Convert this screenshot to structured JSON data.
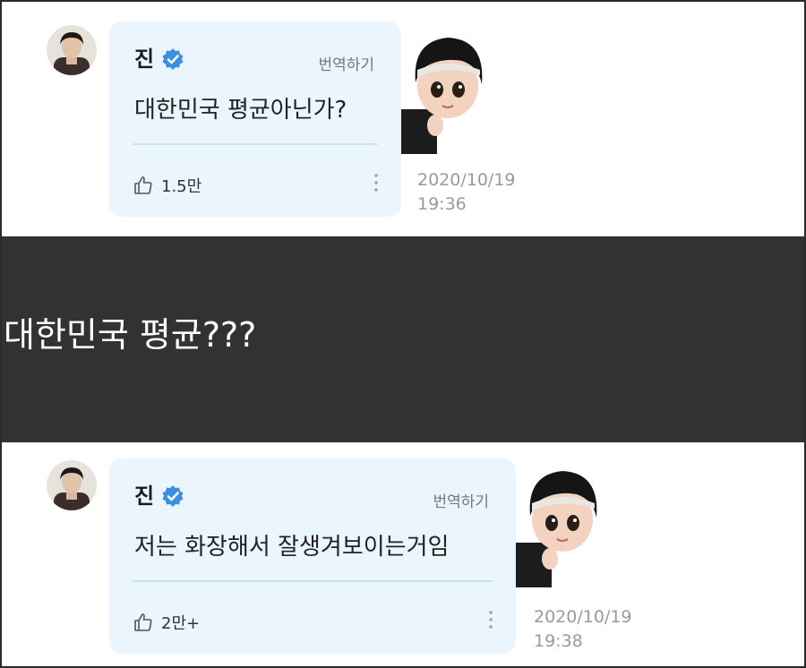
{
  "posts": [
    {
      "author": "진",
      "translate_label": "번역하기",
      "message": "대한민국 평균아닌가?",
      "likes": "1.5만",
      "date": "2020/10/19",
      "time": "19:36"
    },
    {
      "author": "진",
      "translate_label": "번역하기",
      "message": "저는 화장해서 잘생겨보이는거임",
      "likes": "2만+",
      "date": "2020/10/19",
      "time": "19:38"
    }
  ],
  "caption": "대한민국 평균???",
  "colors": {
    "bubble": "#eaf5fd",
    "verified": "#3b8fe0",
    "caption_band": "#323232",
    "timestamp": "#9a9a9a"
  },
  "icons": [
    "verified-badge-icon",
    "thumbs-up-icon",
    "more-vertical-icon"
  ]
}
